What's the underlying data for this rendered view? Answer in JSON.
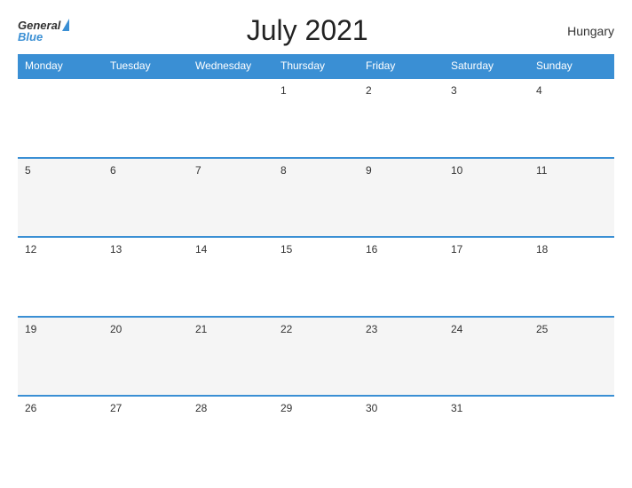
{
  "header": {
    "logo_general": "General",
    "logo_blue": "Blue",
    "title": "July 2021",
    "country": "Hungary"
  },
  "calendar": {
    "weekdays": [
      "Monday",
      "Tuesday",
      "Wednesday",
      "Thursday",
      "Friday",
      "Saturday",
      "Sunday"
    ],
    "weeks": [
      [
        "",
        "",
        "",
        "1",
        "2",
        "3",
        "4"
      ],
      [
        "5",
        "6",
        "7",
        "8",
        "9",
        "10",
        "11"
      ],
      [
        "12",
        "13",
        "14",
        "15",
        "16",
        "17",
        "18"
      ],
      [
        "19",
        "20",
        "21",
        "22",
        "23",
        "24",
        "25"
      ],
      [
        "26",
        "27",
        "28",
        "29",
        "30",
        "31",
        ""
      ]
    ]
  }
}
